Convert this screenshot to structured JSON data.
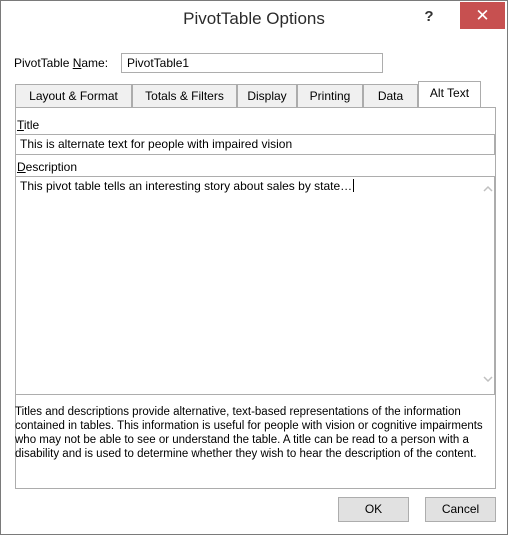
{
  "window": {
    "title": "PivotTable Options",
    "help_glyph": "?",
    "close_glyph": "✕"
  },
  "name_row": {
    "label_before": "PivotTable ",
    "label_underlined": "N",
    "label_after": "ame:",
    "value": "PivotTable1"
  },
  "tabs": [
    {
      "label": "Layout & Format",
      "active": false
    },
    {
      "label": "Totals & Filters",
      "active": false
    },
    {
      "label": "Display",
      "active": false
    },
    {
      "label": "Printing",
      "active": false
    },
    {
      "label": "Data",
      "active": false
    },
    {
      "label": "Alt Text",
      "active": true
    }
  ],
  "alt_text": {
    "title_label_underlined": "T",
    "title_label_rest": "itle",
    "title_value": "This is alternate text for people with impaired vision",
    "description_label_underlined": "D",
    "description_label_rest": "escription",
    "description_value": "This pivot table tells an interesting story about sales by state…",
    "help_text": "Titles and descriptions provide alternative, text-based representations of the information contained in tables. This information is useful for people with vision or cognitive impairments who may not be able to see or understand the table.  A title can be read to a person with a disability and is used to determine whether they wish to hear the description of the content."
  },
  "buttons": {
    "ok": "OK",
    "cancel": "Cancel"
  },
  "icons": {
    "scroll_up": "chevron-up-icon",
    "scroll_down": "chevron-down-icon"
  },
  "colors": {
    "close_button": "#c75050",
    "border": "#acacac"
  }
}
